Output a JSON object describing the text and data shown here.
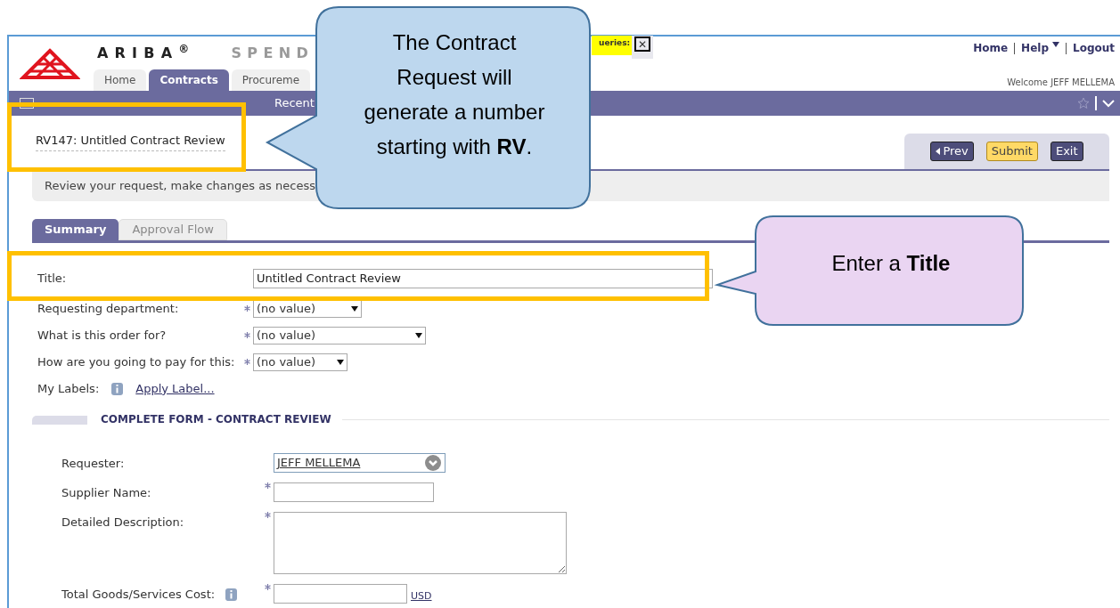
{
  "header": {
    "brand": "ARIBA",
    "brand_mark": "®",
    "product": "SPEND",
    "queries_label": "ueries:",
    "close_glyph": "✕",
    "links": [
      "Home",
      "Help",
      "Logout"
    ],
    "welcome": "Welcome JEFF MELLEMA"
  },
  "main_tabs": [
    {
      "label": "Home",
      "selected": false
    },
    {
      "label": "Contracts",
      "selected": true
    },
    {
      "label": "Procureme",
      "selected": false
    }
  ],
  "nav": {
    "items": [
      "Recent"
    ]
  },
  "document": {
    "title": "RV147: Untitled Contract Review",
    "buttons": [
      {
        "label": "Prev",
        "kind": "prev"
      },
      {
        "label": "Submit",
        "kind": "submit"
      },
      {
        "label": "Exit",
        "kind": "plain"
      }
    ],
    "message": "Review your request, make changes as necess"
  },
  "tabs": [
    {
      "label": "Summary",
      "selected": true
    },
    {
      "label": "Approval Flow",
      "selected": false
    }
  ],
  "fields": [
    {
      "label": "Title:",
      "kind": "text",
      "value": "Untitled Contract Review"
    },
    {
      "label": "Requesting department:",
      "kind": "select",
      "value": "(no value)",
      "required": true
    },
    {
      "label": "What is this order for?",
      "kind": "select",
      "value": "(no value)",
      "required": true
    },
    {
      "label": "How are you going to pay for this:",
      "kind": "select",
      "value": "(no value)",
      "required": true
    },
    {
      "label": "My Labels:",
      "kind": "link",
      "value": "Apply Label..."
    }
  ],
  "section": {
    "title": "COMPLETE FORM - CONTRACT REVIEW",
    "fields": [
      {
        "label": "Requester:",
        "kind": "chooser",
        "value": "JEFF MELLEMA",
        "required": false,
        "info": false
      },
      {
        "label": "Supplier Name:",
        "kind": "text",
        "required": true,
        "info": false
      },
      {
        "label": "Detailed Description:",
        "kind": "textarea",
        "required": true,
        "info": false
      },
      {
        "label": "Total Goods/Services Cost:",
        "kind": "money",
        "unit": "USD",
        "required": true,
        "info": true
      }
    ]
  },
  "callouts": [
    {
      "text": "The Contract Request will generate a number starting with **RV**.",
      "kind": "blue"
    },
    {
      "text": "Enter a **Title**",
      "kind": "purple"
    }
  ]
}
